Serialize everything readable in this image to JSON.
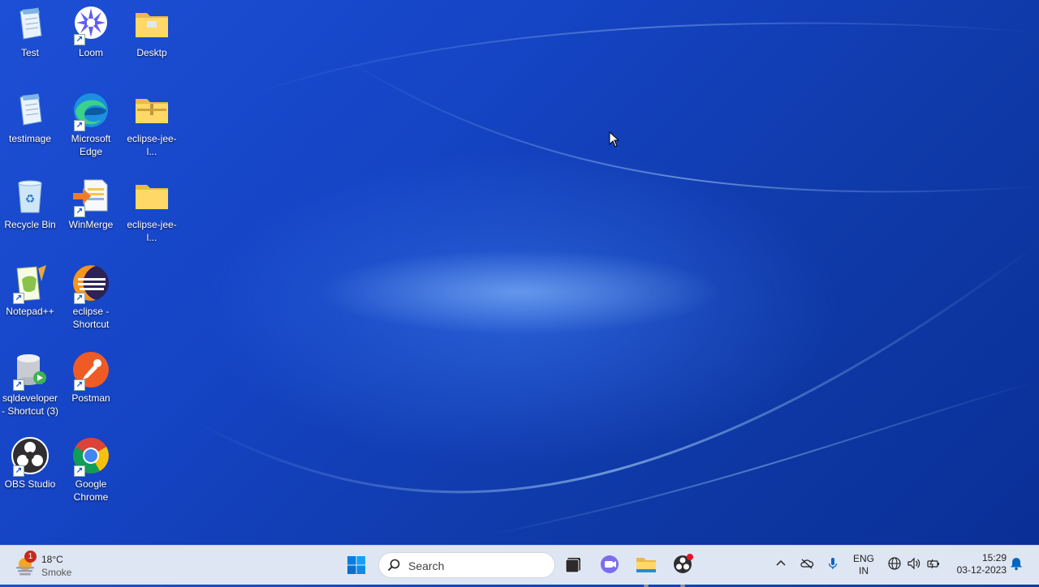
{
  "desktop": {
    "icons": [
      {
        "label": "Test",
        "icon": "notepad-file-icon",
        "shortcut": false
      },
      {
        "label": "Loom",
        "icon": "loom-icon",
        "shortcut": true
      },
      {
        "label": "Desktp",
        "icon": "folder-icon",
        "shortcut": false
      },
      {
        "label": "testimage",
        "icon": "notepad-file-icon",
        "shortcut": false
      },
      {
        "label": "Microsoft Edge",
        "icon": "edge-icon",
        "shortcut": true
      },
      {
        "label": "eclipse-jee-l...",
        "icon": "zip-folder-icon",
        "shortcut": false
      },
      {
        "label": "Recycle Bin",
        "icon": "recycle-bin-icon",
        "shortcut": false
      },
      {
        "label": "WinMerge",
        "icon": "winmerge-icon",
        "shortcut": true
      },
      {
        "label": "eclipse-jee-l...",
        "icon": "folder-icon",
        "shortcut": false
      },
      {
        "label": "Notepad++",
        "icon": "notepad-plus-plus-icon",
        "shortcut": true
      },
      {
        "label": "eclipse - Shortcut",
        "icon": "eclipse-icon",
        "shortcut": true
      },
      {
        "label": "sqldeveloper - Shortcut (3)",
        "icon": "sqldeveloper-icon",
        "shortcut": true
      },
      {
        "label": "Postman",
        "icon": "postman-icon",
        "shortcut": true
      },
      {
        "label": "OBS Studio",
        "icon": "obs-studio-icon",
        "shortcut": true
      },
      {
        "label": "Google Chrome",
        "icon": "chrome-icon",
        "shortcut": true
      }
    ]
  },
  "taskbar": {
    "weather": {
      "temp": "18°C",
      "condition": "Smoke",
      "badge": "1"
    },
    "search": {
      "placeholder": "Search"
    },
    "pinned": [
      "windows-start-icon",
      "terminal-icon",
      "teams-meet-icon",
      "file-explorer-icon",
      "obs-studio-icon"
    ],
    "tray": {
      "lang_line1": "ENG",
      "lang_line2": "IN",
      "time": "15:29",
      "date": "03-12-2023"
    }
  },
  "colors": {
    "desktop_blue": "#1544c4",
    "taskbar_bg": "#dfe6f3",
    "accent": "#0067c0",
    "notification_red": "#c42b1c"
  }
}
